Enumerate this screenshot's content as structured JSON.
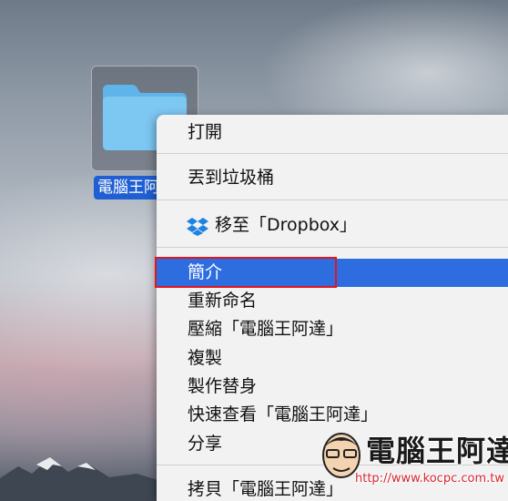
{
  "desktop": {
    "folder_label": "電腦王阿達",
    "edge_char": "2"
  },
  "menu": {
    "items": [
      {
        "label": "打開"
      },
      {
        "label": "丟到垃圾桶"
      },
      {
        "label": "移至「Dropbox」",
        "icon": "dropbox-icon"
      },
      {
        "label": "簡介",
        "selected": true
      },
      {
        "label": "重新命名"
      },
      {
        "label": "壓縮「電腦王阿達」"
      },
      {
        "label": "複製"
      },
      {
        "label": "製作替身"
      },
      {
        "label": "快速查看「電腦王阿達」"
      },
      {
        "label": "分享",
        "has_submenu": true
      },
      {
        "label": "拷貝「電腦王阿達」"
      }
    ]
  },
  "watermark": {
    "title": "電腦王阿達",
    "url": "http://www.kocpc.com.tw"
  },
  "colors": {
    "selection": "#2e6de0",
    "highlight_box": "#e0161e",
    "folder_label_bg": "#1f5fd3"
  }
}
